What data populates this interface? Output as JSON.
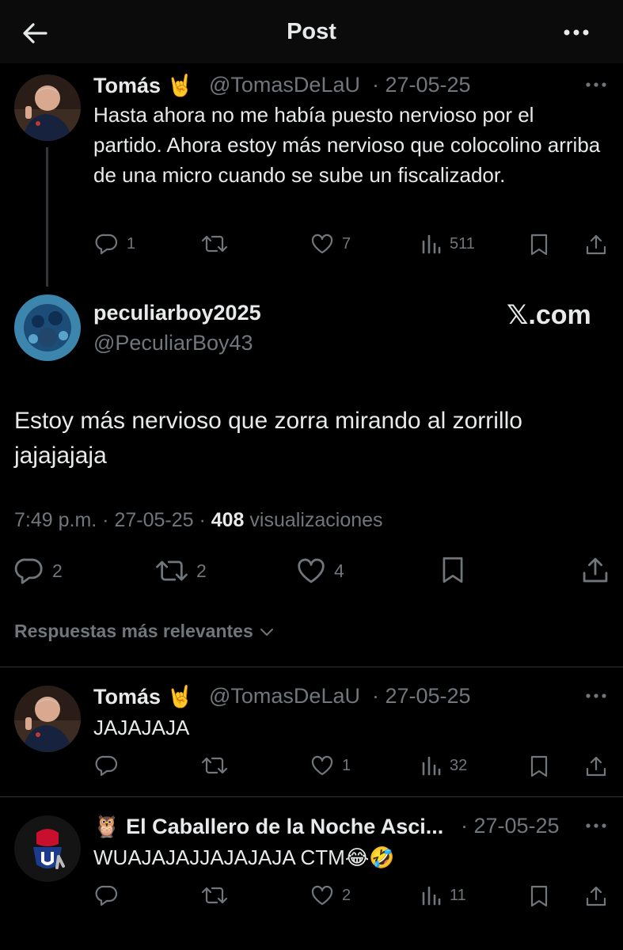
{
  "header": {
    "title": "Post"
  },
  "parent": {
    "name": "Tomás 🤘",
    "handle": "@TomasDeLaU",
    "date": "· 27-05-25",
    "text": "Hasta ahora no me había puesto nervioso por el partido. Ahora estoy más nervioso que colocolino arriba de una micro cuando se sube un fiscalizador.",
    "replies": "1",
    "likes": "7",
    "views": "511"
  },
  "main": {
    "name": "peculiarboy2025",
    "handle": "@PeculiarBoy43",
    "watermark": "𝕏.com",
    "text": "Estoy más nervioso que zorra mirando al zorrillo jajajajaja",
    "time": "7:49 p.m. · 27-05-25 · ",
    "views_count": "408",
    "views_label": " visualizaciones",
    "replies": "2",
    "reposts": "2",
    "likes": "4"
  },
  "sort": {
    "label": "Respuestas más relevantes"
  },
  "reply1": {
    "name": "Tomás 🤘",
    "handle": "@TomasDeLaU",
    "date": "· 27-05-25",
    "text": "JAJAJAJA",
    "likes": "1",
    "views": "32"
  },
  "reply2": {
    "name": "🦉 El Caballero de la Noche Asci...",
    "date": "· 27-05-25",
    "text": "WUAJAJAJJAJAJAJA CTM😂🤣",
    "likes": "2",
    "views": "11"
  },
  "colors": {
    "background": "#000000",
    "text": "#e7e9ea",
    "muted": "#71767b",
    "divider": "#2f3336"
  }
}
